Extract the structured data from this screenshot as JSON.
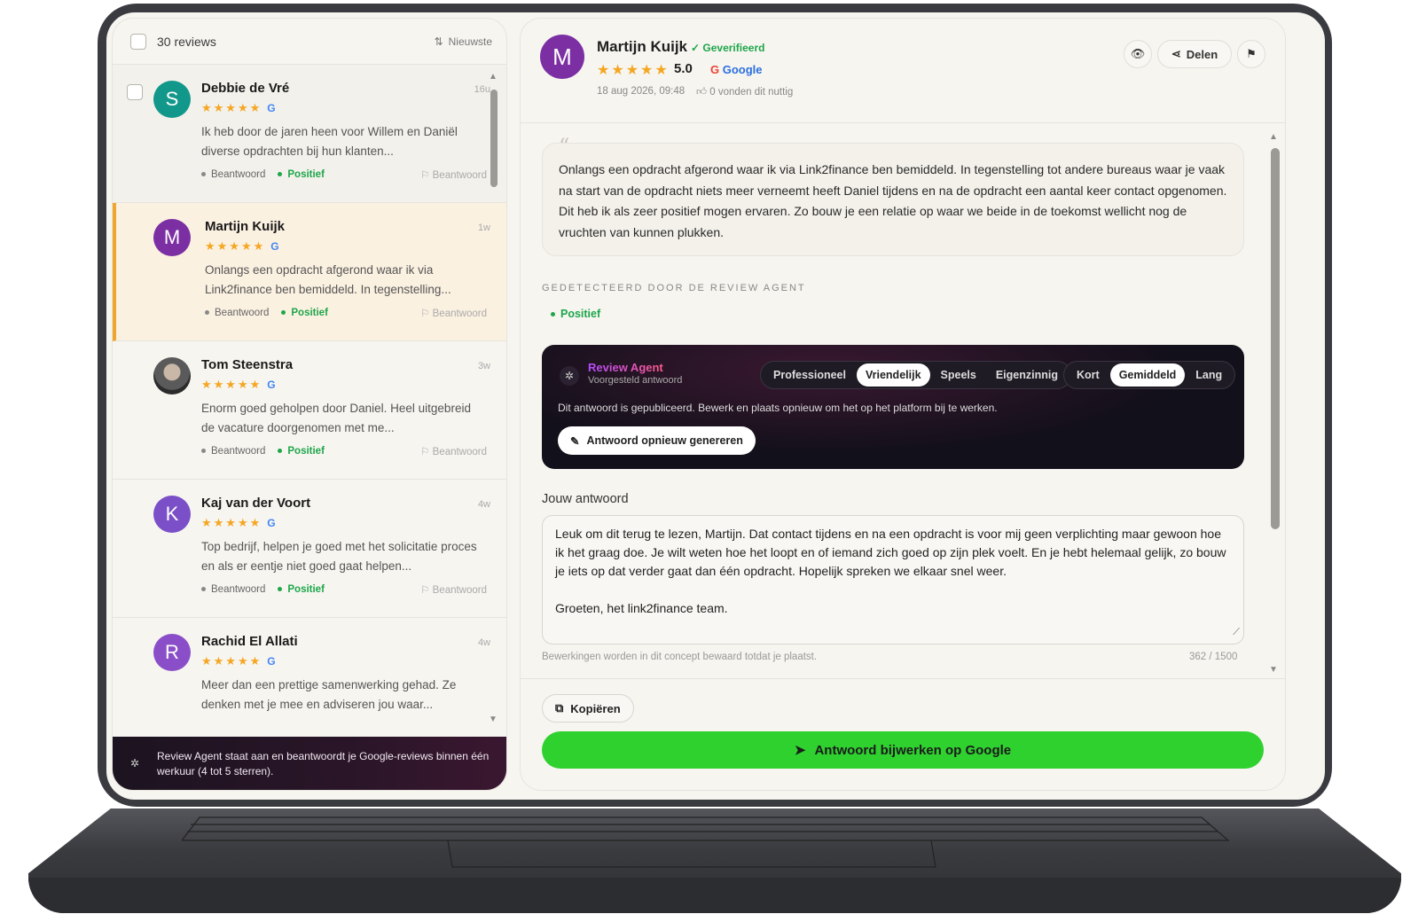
{
  "list": {
    "count_label": "30 reviews",
    "sort_label": "Nieuwste",
    "reviews": [
      {
        "initial": "S",
        "color": "#12988a",
        "name": "Debbie de Vré",
        "time": "16u",
        "snippet": "Ik heb door de jaren heen voor Willem en Daniël diverse opdrachten bij hun klanten...",
        "status": "Beantwoord",
        "sentiment": "Positief",
        "reply_status": "Beantwoord"
      },
      {
        "initial": "M",
        "color": "#7b2fa3",
        "name": "Martijn Kuijk",
        "time": "1w",
        "snippet": "Onlangs een opdracht afgerond waar ik via Link2finance ben bemiddeld. In tegenstelling...",
        "status": "Beantwoord",
        "sentiment": "Positief",
        "reply_status": "Beantwoord"
      },
      {
        "initial": "",
        "color": "#555555",
        "name": "Tom Steenstra",
        "time": "3w",
        "snippet": "Enorm goed geholpen door Daniel. Heel uitgebreid de vacature doorgenomen met me...",
        "status": "Beantwoord",
        "sentiment": "Positief",
        "reply_status": "Beantwoord"
      },
      {
        "initial": "K",
        "color": "#7b4fc8",
        "name": "Kaj van der Voort",
        "time": "4w",
        "snippet": "Top bedrijf, helpen je goed met het solicitatie proces en als er eentje niet goed gaat helpen...",
        "status": "Beantwoord",
        "sentiment": "Positief",
        "reply_status": "Beantwoord"
      },
      {
        "initial": "R",
        "color": "#8a4fc8",
        "name": "Rachid El Allati",
        "time": "4w",
        "snippet": "Meer dan een prettige samenwerking gehad. Ze denken met je mee en adviseren jou waar...",
        "status": "",
        "sentiment": "",
        "reply_status": ""
      }
    ],
    "agent_banner": "Review Agent staat aan en beantwoordt je Google-reviews binnen één werkuur (4 tot 5 sterren)."
  },
  "detail": {
    "initial": "M",
    "name": "Martijn Kuijk",
    "verified": "Geverifieerd",
    "score": "5.0",
    "source": "Google",
    "date": "18 aug 2026, 09:48",
    "useful": "0 vonden dit nuttig",
    "share_label": "Delen",
    "review_text": "Onlangs een opdracht afgerond waar ik via Link2finance ben bemiddeld. In tegenstelling tot andere bureaus waar je vaak na start van de opdracht niets meer verneemt heeft Daniel tijdens en na de opdracht een aantal keer contact opgenomen. Dit heb ik als zeer positief mogen ervaren. Zo bouw je een relatie op waar we beide in de toekomst wellicht nog de vruchten van kunnen plukken.",
    "detected_label": "GEDETECTEERD DOOR DE REVIEW AGENT",
    "detected_tag": "Positief"
  },
  "agent": {
    "title": "Review Agent",
    "subtitle": "Voorgesteld antwoord",
    "tones": [
      "Professioneel",
      "Vriendelijk",
      "Speels",
      "Eigenzinnig"
    ],
    "tone_selected": "Vriendelijk",
    "lengths": [
      "Kort",
      "Gemiddeld",
      "Lang"
    ],
    "length_selected": "Gemiddeld",
    "note": "Dit antwoord is gepubliceerd. Bewerk en plaats opnieuw om het op het platform bij te werken.",
    "regen_label": "Antwoord opnieuw genereren"
  },
  "answer": {
    "label": "Jouw antwoord",
    "text": "Leuk om dit terug te lezen, Martijn. Dat contact tijdens en na een opdracht is voor mij geen verplichting maar gewoon hoe ik het graag doe. Je wilt weten hoe het loopt en of iemand zich goed op zijn plek voelt. En je hebt helemaal gelijk, zo bouw je iets op dat verder gaat dan één opdracht. Hopelijk spreken we elkaar snel weer.\n\nGroeten, het link2finance team.",
    "hint": "Bewerkingen worden in dit concept bewaard totdat je plaatst.",
    "char_count": "362 / 1500",
    "copy_label": "Kopiëren",
    "publish_label": "Antwoord bijwerken op Google"
  },
  "colors": {
    "accent_green": "#2fd12f",
    "positive": "#1ea64a",
    "star": "#f5a623",
    "active_border": "#f0a530"
  }
}
